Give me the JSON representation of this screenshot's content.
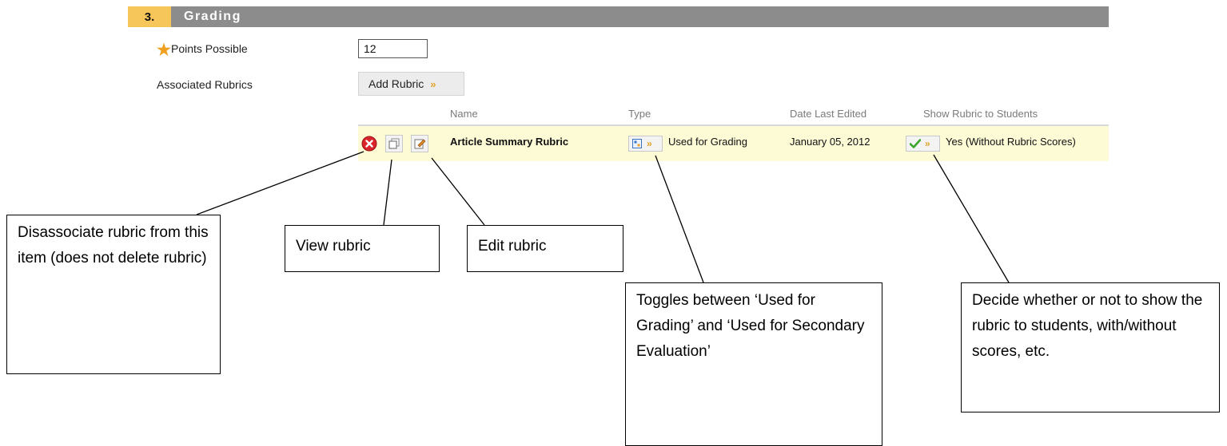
{
  "section": {
    "number": "3.",
    "title": "Grading"
  },
  "points": {
    "label": "Points Possible",
    "value": "12",
    "required_star": "★"
  },
  "rubrics": {
    "label": "Associated Rubrics",
    "add_button": "Add Rubric",
    "columns": {
      "name": "Name",
      "type": "Type",
      "date": "Date Last Edited",
      "show": "Show Rubric to Students"
    },
    "row": {
      "name": "Article Summary Rubric",
      "type": "Used for Grading",
      "date": "January 05, 2012",
      "show": "Yes (Without Rubric Scores)"
    }
  },
  "callouts": {
    "disassociate": "Disassociate rubric from this item (does not delete rubric)",
    "view": "View rubric",
    "edit": "Edit rubric",
    "toggle": "Toggles between ‘Used for Grading’ and ‘Used for Secondary Evaluation’",
    "show": "Decide whether or not to show the rubric to students, with/without scores, etc."
  },
  "colors": {
    "section_number_bg": "#f7c65a",
    "section_bar_bg": "#8c8c8c",
    "row_highlight": "#fdfbd6",
    "required_star": "#f0a020",
    "chevron": "#e2a328"
  },
  "icons": [
    "remove-icon",
    "view-rubric-icon",
    "edit-rubric-icon",
    "type-grid-icon",
    "checkmark-icon",
    "chevron-down-icon"
  ]
}
